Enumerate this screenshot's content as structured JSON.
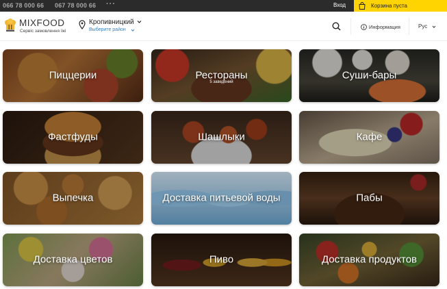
{
  "topbar": {
    "phone1": "066 78 000 66",
    "phone2": "067 78 000 66",
    "more": "···",
    "login": "Вход",
    "cart": "Корзина пуста"
  },
  "header": {
    "logo_title": "MIXFOOD",
    "logo_subtitle": "Сервіс замовлення їжі",
    "city": "Кропивницкий",
    "district_placeholder": "Выберите район",
    "info": "Информация",
    "lang": "Рус"
  },
  "colors": {
    "accent": "#ffd400",
    "topbar": "#2b2b2b",
    "link": "#3c82c2"
  },
  "categories": [
    {
      "label": "Пиццерии",
      "subtitle": "",
      "icon": "pizza-photo"
    },
    {
      "label": "Рестораны",
      "subtitle": "5 заведений",
      "icon": "restaurant-photo"
    },
    {
      "label": "Суши-бары",
      "subtitle": "",
      "icon": "sushi-photo"
    },
    {
      "label": "Фастфуды",
      "subtitle": "",
      "icon": "burger-photo"
    },
    {
      "label": "Шашлыки",
      "subtitle": "",
      "icon": "kebab-photo"
    },
    {
      "label": "Кафе",
      "subtitle": "",
      "icon": "cake-photo"
    },
    {
      "label": "Выпечка",
      "subtitle": "",
      "icon": "pastry-photo"
    },
    {
      "label": "Доставка питьевой воды",
      "subtitle": "",
      "icon": "water-photo"
    },
    {
      "label": "Пабы",
      "subtitle": "",
      "icon": "pub-photo"
    },
    {
      "label": "Доставка цветов",
      "subtitle": "",
      "icon": "flowers-photo"
    },
    {
      "label": "Пиво",
      "subtitle": "",
      "icon": "beer-photo"
    },
    {
      "label": "Доставка продуктов",
      "subtitle": "",
      "icon": "grocery-photo"
    }
  ]
}
